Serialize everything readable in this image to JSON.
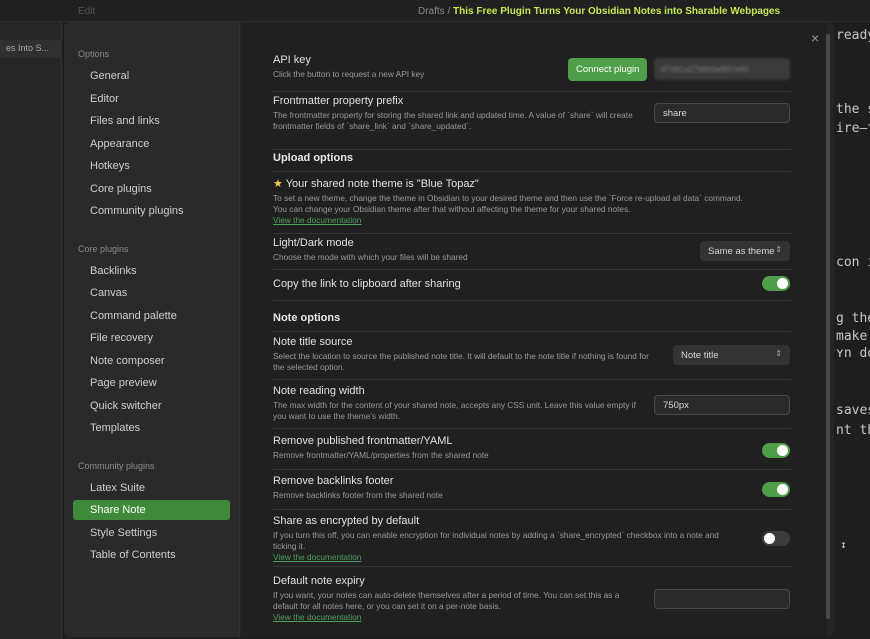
{
  "background": {
    "breadcrumb_prefix": "Drafts /",
    "breadcrumb_title": "This Free Plugin Turns Your Obsidian Notes into Sharable Webpages",
    "edit_label": "Edit",
    "tab_label": "es Into S...",
    "text_lines": [
      "ready,",
      "the s",
      "ire—th",
      "con in",
      "g the l",
      "make",
      "ʏn don",
      "saves",
      "nt ther",
      "↕"
    ]
  },
  "sidebar": {
    "options_header": "Options",
    "options": [
      "General",
      "Editor",
      "Files and links",
      "Appearance",
      "Hotkeys",
      "Core plugins",
      "Community plugins"
    ],
    "core_header": "Core plugins",
    "core": [
      "Backlinks",
      "Canvas",
      "Command palette",
      "File recovery",
      "Note composer",
      "Page preview",
      "Quick switcher",
      "Templates"
    ],
    "community_header": "Community plugins",
    "community": [
      "Latex Suite",
      "Share Note",
      "Style Settings",
      "Table of Contents"
    ]
  },
  "settings": {
    "close_label": "×",
    "api_key": {
      "name": "API key",
      "desc": "Click the button to request a new API key",
      "button": "Connect plugin",
      "value": "4f7d91a27b8b0e8f07e65"
    },
    "frontmatter_prefix": {
      "name": "Frontmatter property prefix",
      "desc": "The frontmatter property for storing the shared link and updated time. A value of `share` will create frontmatter fields of `share_link` and `share_updated`.",
      "value": "share"
    },
    "upload_heading": "Upload options",
    "theme": {
      "icon": "star-icon",
      "name": "Your shared note theme is \"Blue Topaz\"",
      "desc": "To set a new theme, change the theme in Obsidian to your desired theme and then use the `Force re-upload all data` command. You can change your Obsidian theme after that without affecting the theme for your shared notes.",
      "link": "View the documentation"
    },
    "mode": {
      "name": "Light/Dark mode",
      "desc": "Choose the mode with which your files will be shared",
      "value": "Same as theme"
    },
    "copy_link": {
      "name": "Copy the link to clipboard after sharing",
      "enabled": true
    },
    "note_heading": "Note options",
    "title_source": {
      "name": "Note title source",
      "desc": "Select the location to source the published note title. It will default to the note title if nothing is found for the selected option.",
      "value": "Note title"
    },
    "reading_width": {
      "name": "Note reading width",
      "desc": "The max width for the content of your shared note, accepts any CSS unit. Leave this value empty if you want to use the theme's width.",
      "value": "750px"
    },
    "remove_frontmatter": {
      "name": "Remove published frontmatter/YAML",
      "desc": "Remove frontmatter/YAML/properties from the shared note",
      "enabled": true
    },
    "remove_backlinks": {
      "name": "Remove backlinks footer",
      "desc": "Remove backlinks footer from the shared note",
      "enabled": true
    },
    "encrypted": {
      "name": "Share as encrypted by default",
      "desc": "If you turn this off, you can enable encryption for individual notes by adding a `share_encrypted` checkbox into a note and ticking it.",
      "link": "View the documentation",
      "enabled": false
    },
    "expiry": {
      "name": "Default note expiry",
      "desc": "If you want, your notes can auto-delete themselves after a period of time. You can set this as a default for all notes here, or you can set it on a per-note basis.",
      "link": "View the documentation",
      "value": ""
    }
  }
}
